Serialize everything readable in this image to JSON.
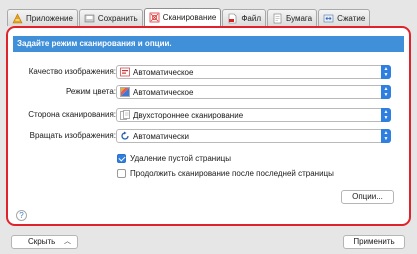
{
  "tabs": [
    {
      "label": "Приложение",
      "icon": "application-icon"
    },
    {
      "label": "Сохранить",
      "icon": "save-icon"
    },
    {
      "label": "Сканирование",
      "icon": "scanning-icon",
      "active": true
    },
    {
      "label": "Файл",
      "icon": "file-icon"
    },
    {
      "label": "Бумага",
      "icon": "paper-icon"
    },
    {
      "label": "Сжатие",
      "icon": "compression-icon"
    }
  ],
  "panel": {
    "header": "Задайте режим сканирования и опции.",
    "fields": {
      "quality": {
        "label": "Качество изображения:",
        "value": "Автоматическое"
      },
      "color": {
        "label": "Режим цвета:",
        "value": "Автоматическое"
      },
      "side": {
        "label": "Сторона сканирования:",
        "value": "Двухстороннее сканирование"
      },
      "rotate": {
        "label": "Вращать изображения:",
        "value": "Автоматически"
      }
    },
    "checkboxes": {
      "blank": {
        "label": "Удаление пустой страницы",
        "checked": true
      },
      "continue": {
        "label": "Продолжить сканирование после последней страницы",
        "checked": false
      }
    },
    "options_button": "Опции...",
    "help": "?"
  },
  "footer": {
    "hide_button": "Скрыть",
    "apply_button": "Применить"
  },
  "colors": {
    "accent": "#3f8fd9",
    "highlight_border": "#e0232b",
    "stepper": "#2f7fe0"
  }
}
